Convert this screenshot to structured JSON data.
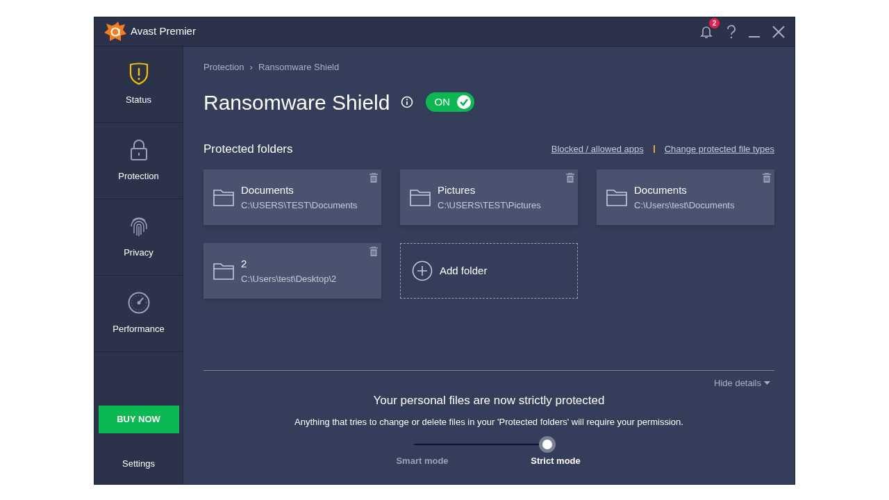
{
  "window": {
    "title": "Avast Premier",
    "notifications": "2"
  },
  "sidebar": {
    "items": [
      {
        "label": "Status",
        "kind": "status"
      },
      {
        "label": "Protection",
        "kind": "protection"
      },
      {
        "label": "Privacy",
        "kind": "privacy"
      },
      {
        "label": "Performance",
        "kind": "performance"
      }
    ],
    "buy_button": "BUY NOW",
    "settings": "Settings"
  },
  "breadcrumb": [
    "Protection",
    "Ransomware Shield"
  ],
  "breadcrumb_separator": "›",
  "heading": {
    "title": "Ransomware Shield",
    "toggle": {
      "label": "ON",
      "on": true
    }
  },
  "section": {
    "title": "Protected folders",
    "links": [
      "Blocked / allowed apps",
      "Change protected file types"
    ]
  },
  "folders": [
    {
      "name": "Documents",
      "path": "C:\\USERS\\TEST\\Documents"
    },
    {
      "name": "Pictures",
      "path": "C:\\USERS\\TEST\\Pictures"
    },
    {
      "name": "Documents",
      "path": "C:\\Users\\test\\Documents"
    },
    {
      "name": "2",
      "path": "C:\\Users\\test\\Desktop\\2"
    }
  ],
  "add_folder": "Add folder",
  "details": {
    "hide_label": "Hide details",
    "headline": "Your personal files are now strictly protected",
    "text": "Anything that tries to change or delete files in your 'Protected folders' will require your permission.",
    "mode_slider": {
      "level": 1,
      "modes": [
        {
          "label": "Smart mode",
          "selected": false
        },
        {
          "label": "Strict mode",
          "selected": true
        }
      ]
    }
  }
}
